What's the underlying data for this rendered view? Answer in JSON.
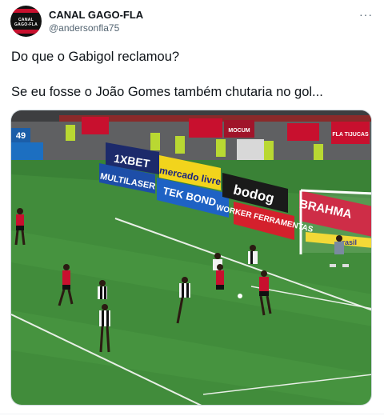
{
  "tweet": {
    "author_name": "CANAL GAGO-FLA",
    "author_handle": "@andersonfla75",
    "avatar_text": "CANAL GAGO-FLA",
    "more_label": "···",
    "line1": "Do que o Gabigol reclamou?",
    "line2": "Se eu fosse o João Gomes também chutaria no gol..."
  },
  "media": {
    "scoreboard_minute": "49",
    "ads": {
      "ad_1xbet": "1XBET",
      "ad_mercado": "mercado livre",
      "ad_multilaser": "MULTILASER",
      "ad_tekbond": "TEK BOND",
      "ad_bodog": "bodog",
      "ad_worker": "WORKER FERRAMENTAS",
      "ad_brahma": "BRAHMA",
      "ad_brasil": "brasil",
      "ad_fla_tijucas": "FLA TIJUCAS",
      "ad_mocum": "MOCUM"
    },
    "colors": {
      "pitch": "#3f8a3a",
      "pitch_light": "#4a9743",
      "stands": "#6b6b6b",
      "flamengo_red": "#c8102e",
      "atletico_white": "#f2f2f2"
    }
  }
}
